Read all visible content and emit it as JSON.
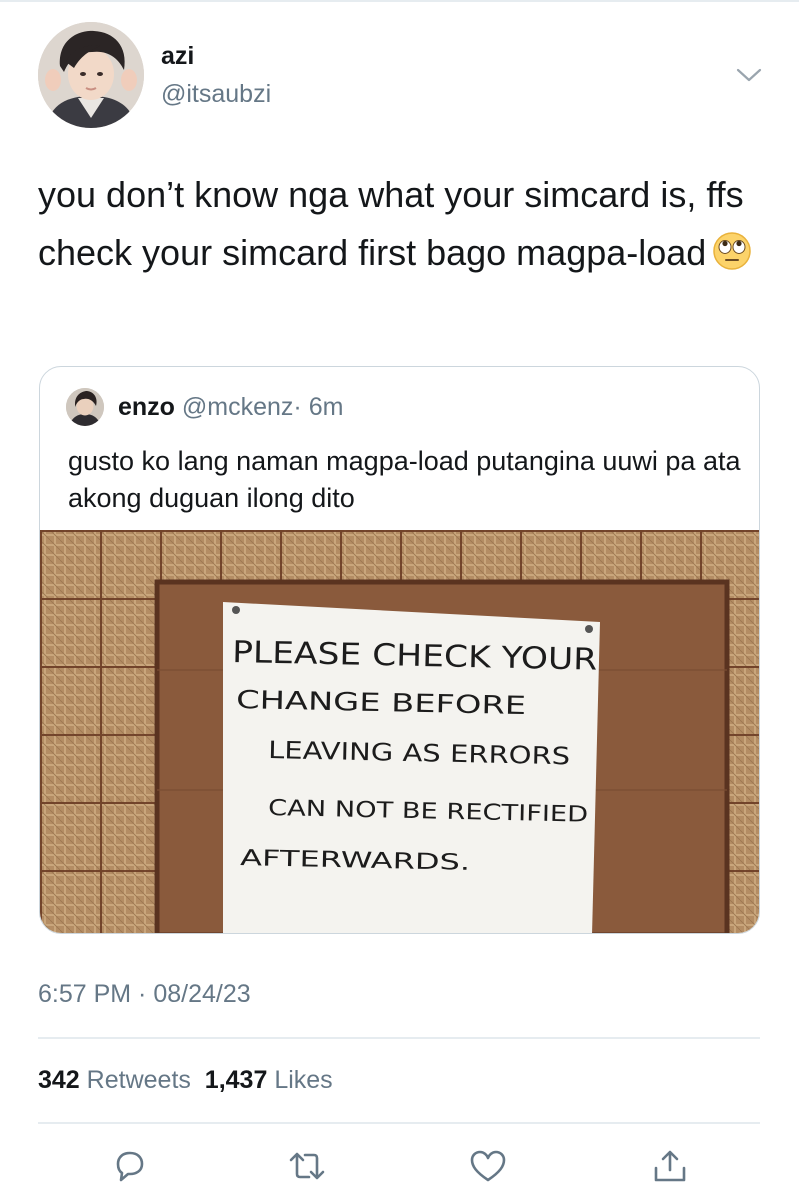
{
  "tweet": {
    "author": {
      "name": "azi",
      "handle": "@itsaubzi"
    },
    "text": "you don’t know nga what your simcard is, ffs check your simcard first bago magpa-load",
    "emoji": "face-with-rolling-eyes",
    "timestamp": "6:57 PM · 08/24/23",
    "stats": {
      "retweets": "342",
      "retweets_label": "Retweets",
      "likes": "1,437",
      "likes_label": "Likes"
    }
  },
  "quoted_tweet": {
    "name": "enzo",
    "handle": "@mckenz",
    "time": "· 6m",
    "text": "gusto ko lang naman magpa-load putangina uuwi pa ata akong duguan ilong dito",
    "photo": {
      "sign_lines": [
        "PLEASE CHECK YOUR",
        "CHANGE BEFORE",
        "LEAVING AS ERRORS",
        "CAN NOT BE RECTIFIED",
        "AFTERWARDS."
      ]
    }
  },
  "actions": [
    "reply-icon",
    "retweet-icon",
    "like-icon",
    "share-icon"
  ],
  "colors": {
    "text": "#14171a",
    "secondary": "#657786",
    "border": "#ccd6dd",
    "divider": "#e6ecf0",
    "icon": "#657786"
  }
}
